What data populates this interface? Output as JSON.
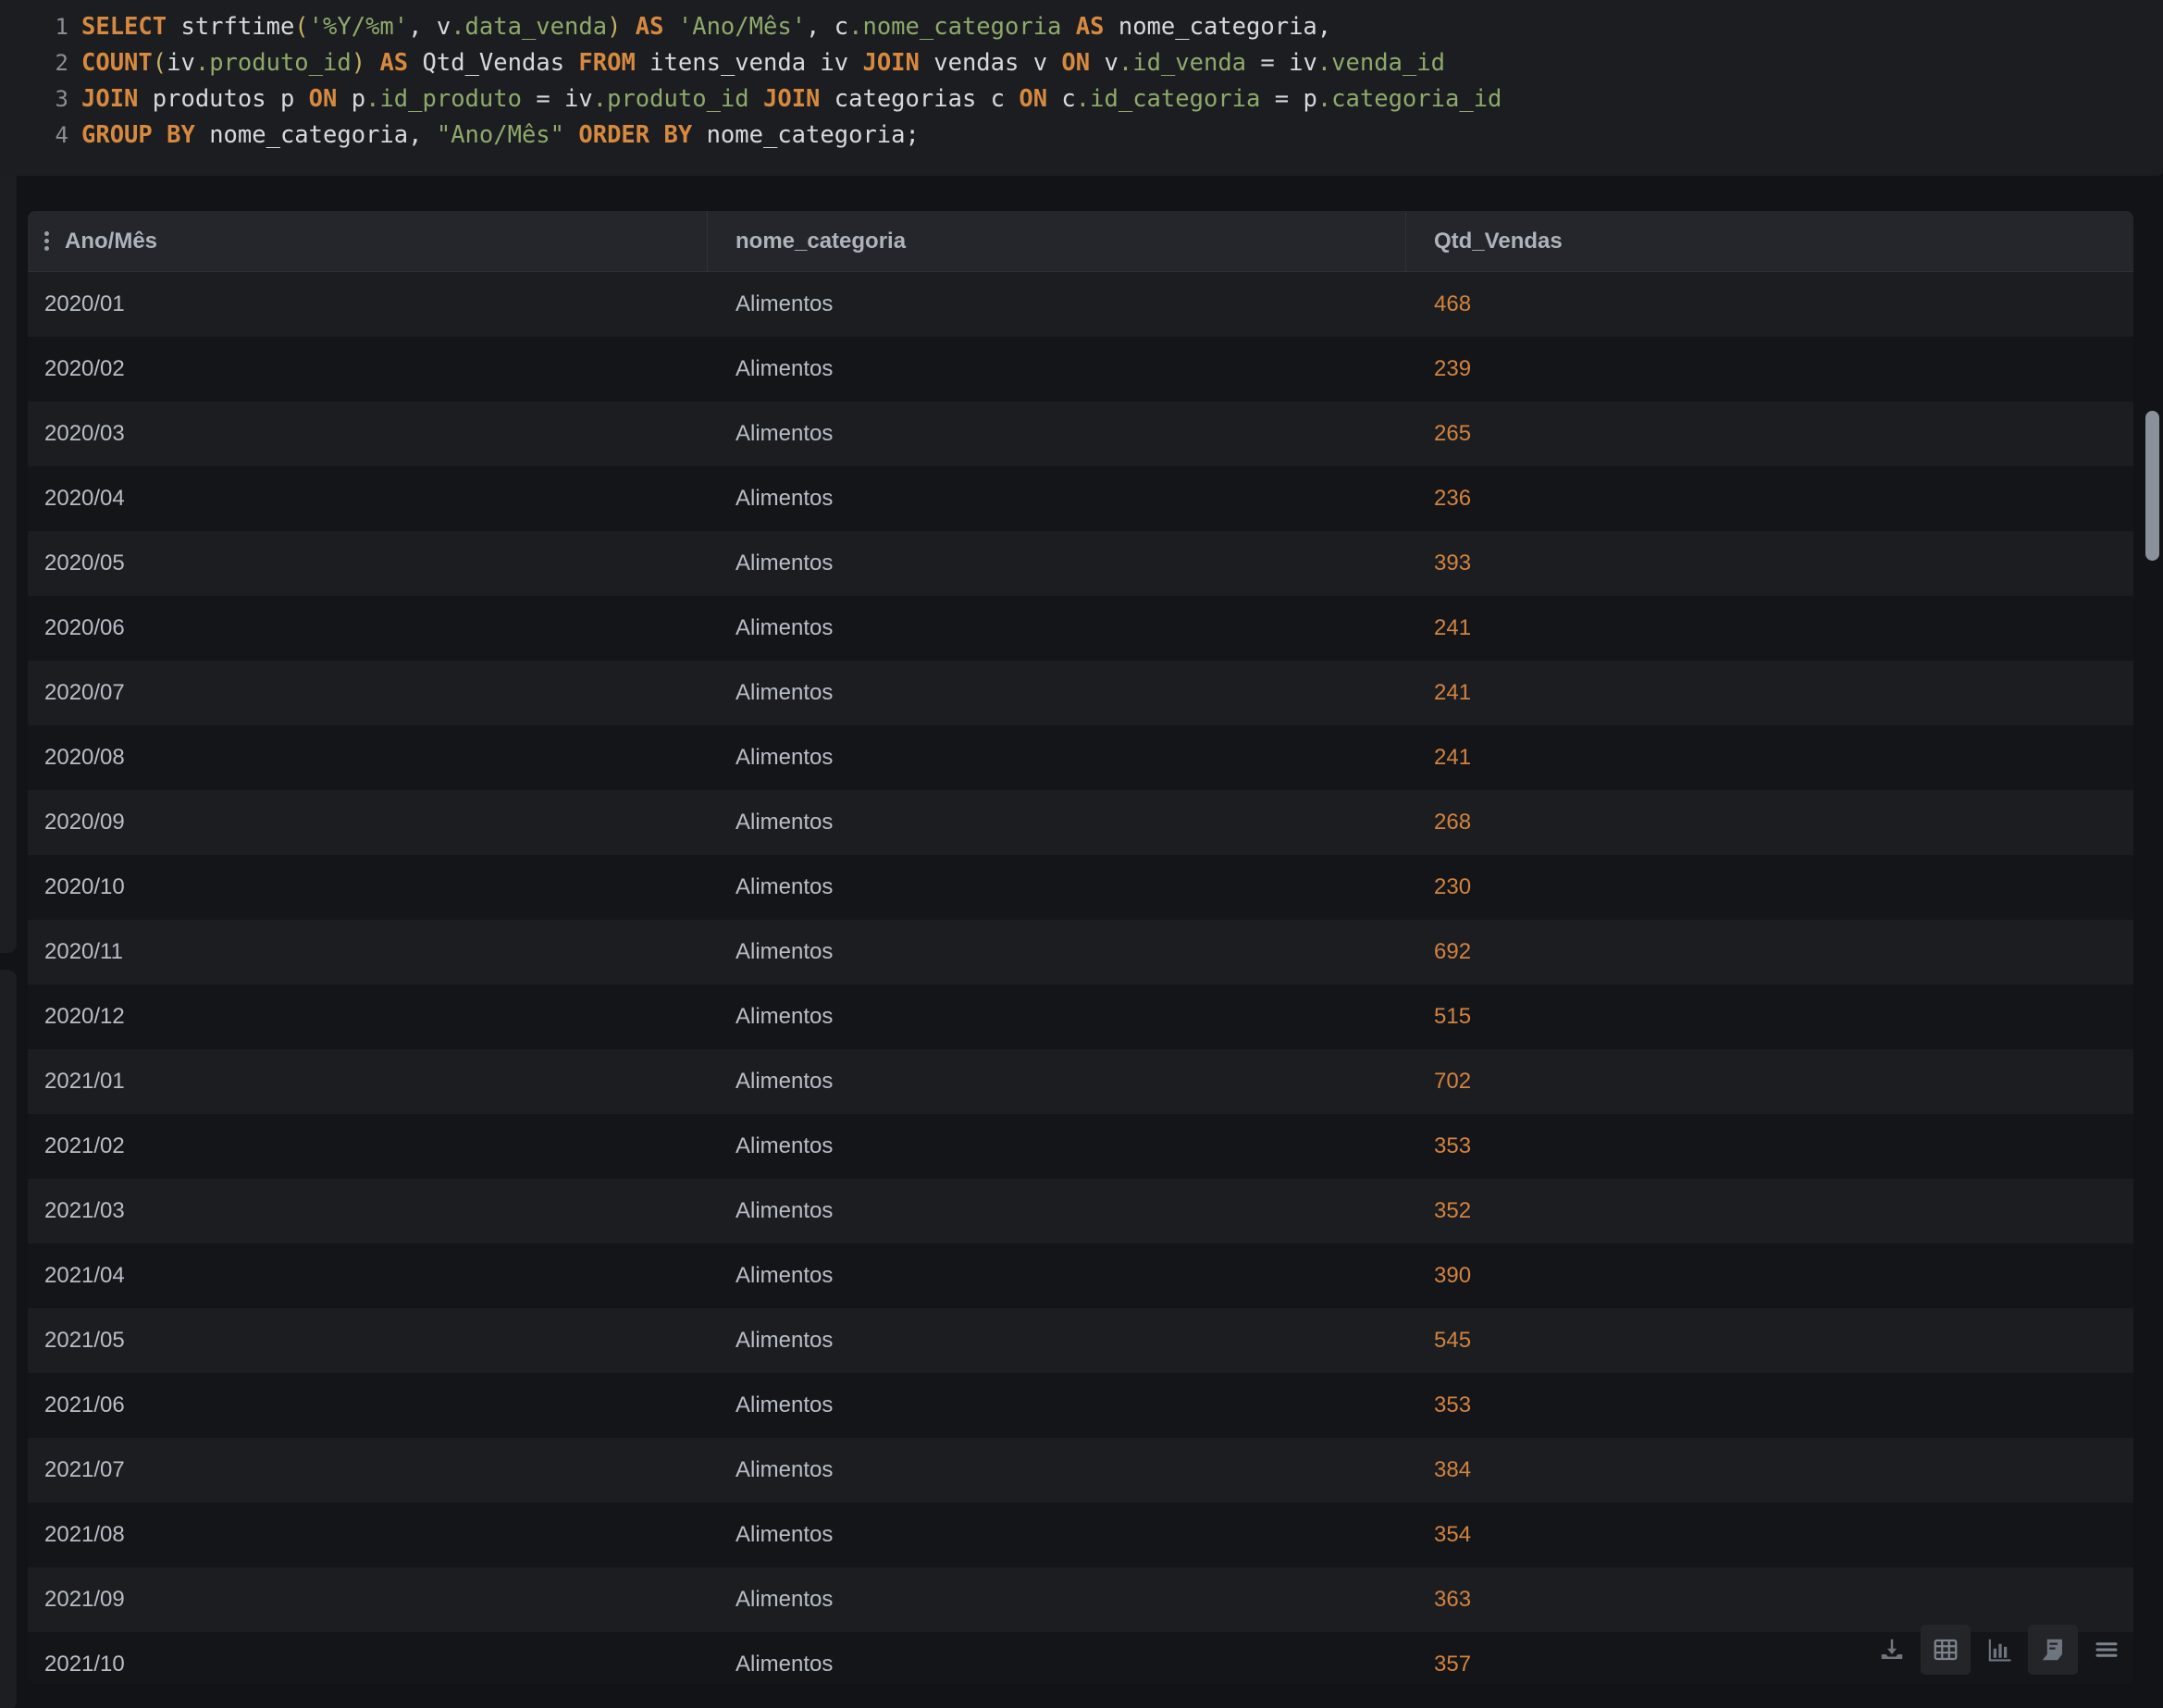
{
  "editor": {
    "lines": [
      {
        "number": "1",
        "tokens": [
          {
            "t": "SELECT",
            "c": "kw"
          },
          {
            "t": " strftime",
            "c": "plain"
          },
          {
            "t": "(",
            "c": "pun"
          },
          {
            "t": "'%Y/%m'",
            "c": "str"
          },
          {
            "t": ", v",
            "c": "plain"
          },
          {
            "t": ".data_venda",
            "c": "ident"
          },
          {
            "t": ")",
            "c": "pun"
          },
          {
            "t": " ",
            "c": "plain"
          },
          {
            "t": "AS",
            "c": "kw"
          },
          {
            "t": " ",
            "c": "plain"
          },
          {
            "t": "'Ano/Mês'",
            "c": "str"
          },
          {
            "t": ", c",
            "c": "plain"
          },
          {
            "t": ".nome_categoria",
            "c": "ident"
          },
          {
            "t": " ",
            "c": "plain"
          },
          {
            "t": "AS",
            "c": "kw"
          },
          {
            "t": " nome_categoria,",
            "c": "plain"
          }
        ]
      },
      {
        "number": "2",
        "tokens": [
          {
            "t": "COUNT",
            "c": "kw"
          },
          {
            "t": "(",
            "c": "pun"
          },
          {
            "t": "iv",
            "c": "plain"
          },
          {
            "t": ".produto_id",
            "c": "ident"
          },
          {
            "t": ")",
            "c": "pun"
          },
          {
            "t": " ",
            "c": "plain"
          },
          {
            "t": "AS",
            "c": "kw"
          },
          {
            "t": " Qtd_Vendas ",
            "c": "plain"
          },
          {
            "t": "FROM",
            "c": "kw"
          },
          {
            "t": " itens_venda iv ",
            "c": "plain"
          },
          {
            "t": "JOIN",
            "c": "kw"
          },
          {
            "t": " vendas v ",
            "c": "plain"
          },
          {
            "t": "ON",
            "c": "kw"
          },
          {
            "t": " v",
            "c": "plain"
          },
          {
            "t": ".id_venda",
            "c": "ident"
          },
          {
            "t": " = iv",
            "c": "plain"
          },
          {
            "t": ".venda_id",
            "c": "ident"
          }
        ]
      },
      {
        "number": "3",
        "tokens": [
          {
            "t": "JOIN",
            "c": "kw"
          },
          {
            "t": " produtos p ",
            "c": "plain"
          },
          {
            "t": "ON",
            "c": "kw"
          },
          {
            "t": " p",
            "c": "plain"
          },
          {
            "t": ".id_produto",
            "c": "ident"
          },
          {
            "t": " = iv",
            "c": "plain"
          },
          {
            "t": ".produto_id",
            "c": "ident"
          },
          {
            "t": " ",
            "c": "plain"
          },
          {
            "t": "JOIN",
            "c": "kw"
          },
          {
            "t": " categorias c ",
            "c": "plain"
          },
          {
            "t": "ON",
            "c": "kw"
          },
          {
            "t": " c",
            "c": "plain"
          },
          {
            "t": ".id_categoria",
            "c": "ident"
          },
          {
            "t": " = p",
            "c": "plain"
          },
          {
            "t": ".categoria_id",
            "c": "ident"
          }
        ]
      },
      {
        "number": "4",
        "tokens": [
          {
            "t": "GROUP",
            "c": "kw"
          },
          {
            "t": " ",
            "c": "plain"
          },
          {
            "t": "BY",
            "c": "kw"
          },
          {
            "t": " nome_categoria, ",
            "c": "plain"
          },
          {
            "t": "\"Ano/Mês\"",
            "c": "str"
          },
          {
            "t": " ",
            "c": "plain"
          },
          {
            "t": "ORDER",
            "c": "kw"
          },
          {
            "t": " ",
            "c": "plain"
          },
          {
            "t": "BY",
            "c": "kw"
          },
          {
            "t": " nome_categoria;",
            "c": "plain"
          }
        ]
      }
    ]
  },
  "table": {
    "columns": [
      "Ano/Mês",
      "nome_categoria",
      "Qtd_Vendas"
    ],
    "rows": [
      [
        "2020/01",
        "Alimentos",
        "468"
      ],
      [
        "2020/02",
        "Alimentos",
        "239"
      ],
      [
        "2020/03",
        "Alimentos",
        "265"
      ],
      [
        "2020/04",
        "Alimentos",
        "236"
      ],
      [
        "2020/05",
        "Alimentos",
        "393"
      ],
      [
        "2020/06",
        "Alimentos",
        "241"
      ],
      [
        "2020/07",
        "Alimentos",
        "241"
      ],
      [
        "2020/08",
        "Alimentos",
        "241"
      ],
      [
        "2020/09",
        "Alimentos",
        "268"
      ],
      [
        "2020/10",
        "Alimentos",
        "230"
      ],
      [
        "2020/11",
        "Alimentos",
        "692"
      ],
      [
        "2020/12",
        "Alimentos",
        "515"
      ],
      [
        "2021/01",
        "Alimentos",
        "702"
      ],
      [
        "2021/02",
        "Alimentos",
        "353"
      ],
      [
        "2021/03",
        "Alimentos",
        "352"
      ],
      [
        "2021/04",
        "Alimentos",
        "390"
      ],
      [
        "2021/05",
        "Alimentos",
        "545"
      ],
      [
        "2021/06",
        "Alimentos",
        "353"
      ],
      [
        "2021/07",
        "Alimentos",
        "384"
      ],
      [
        "2021/08",
        "Alimentos",
        "354"
      ],
      [
        "2021/09",
        "Alimentos",
        "363"
      ],
      [
        "2021/10",
        "Alimentos",
        "357"
      ]
    ]
  },
  "toolbar": {
    "buttons": [
      {
        "icon": "download-icon",
        "highlight": false
      },
      {
        "icon": "table-grid-icon",
        "highlight": true
      },
      {
        "icon": "bar-chart-icon",
        "highlight": false
      },
      {
        "icon": "book-icon",
        "highlight": true
      },
      {
        "icon": "hamburger-menu-icon",
        "highlight": false
      }
    ]
  },
  "colors": {
    "page_background": "#121316",
    "editor_background": "#1b1d21",
    "table_background": "#17181c",
    "header_background": "#24262b",
    "row_odd": "#1b1d21",
    "row_even": "#141519",
    "keyword": "#d78a3f",
    "string": "#8fa96b",
    "identifier": "#8fa96b",
    "punctuation": "#c7b063",
    "plain_text": "#d6d9de",
    "value_accent": "#d2833f",
    "cell_text": "#b9bec6",
    "header_text": "#aeb3bb",
    "scrollbar_thumb": "#8b919b"
  }
}
